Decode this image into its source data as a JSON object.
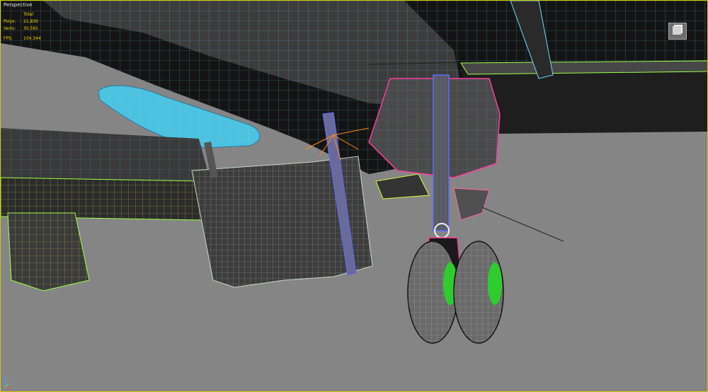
{
  "viewport": {
    "label": "Perspective",
    "stats": {
      "header": "Total",
      "rows": [
        {
          "key": "Polys:",
          "value": "21,830"
        },
        {
          "key": "Verts:",
          "value": "30,591"
        }
      ],
      "fps_key": "FPS:",
      "fps_value": "104.344"
    }
  },
  "scene": {
    "background": "#828282",
    "shaded_body": "#3a3a3a",
    "dark_body": "#0e0e0e",
    "wire_cyan": "#6fd8ff",
    "wire_green": "#9dff4a",
    "wire_magenta": "#ff3a9e",
    "wire_blue": "#5a6cff",
    "wire_yellow": "#ffe04a",
    "pod_color": "#4cc2e0"
  },
  "icons": {
    "viewcube": "viewcube-icon",
    "axis": "axis-tripod-icon"
  }
}
